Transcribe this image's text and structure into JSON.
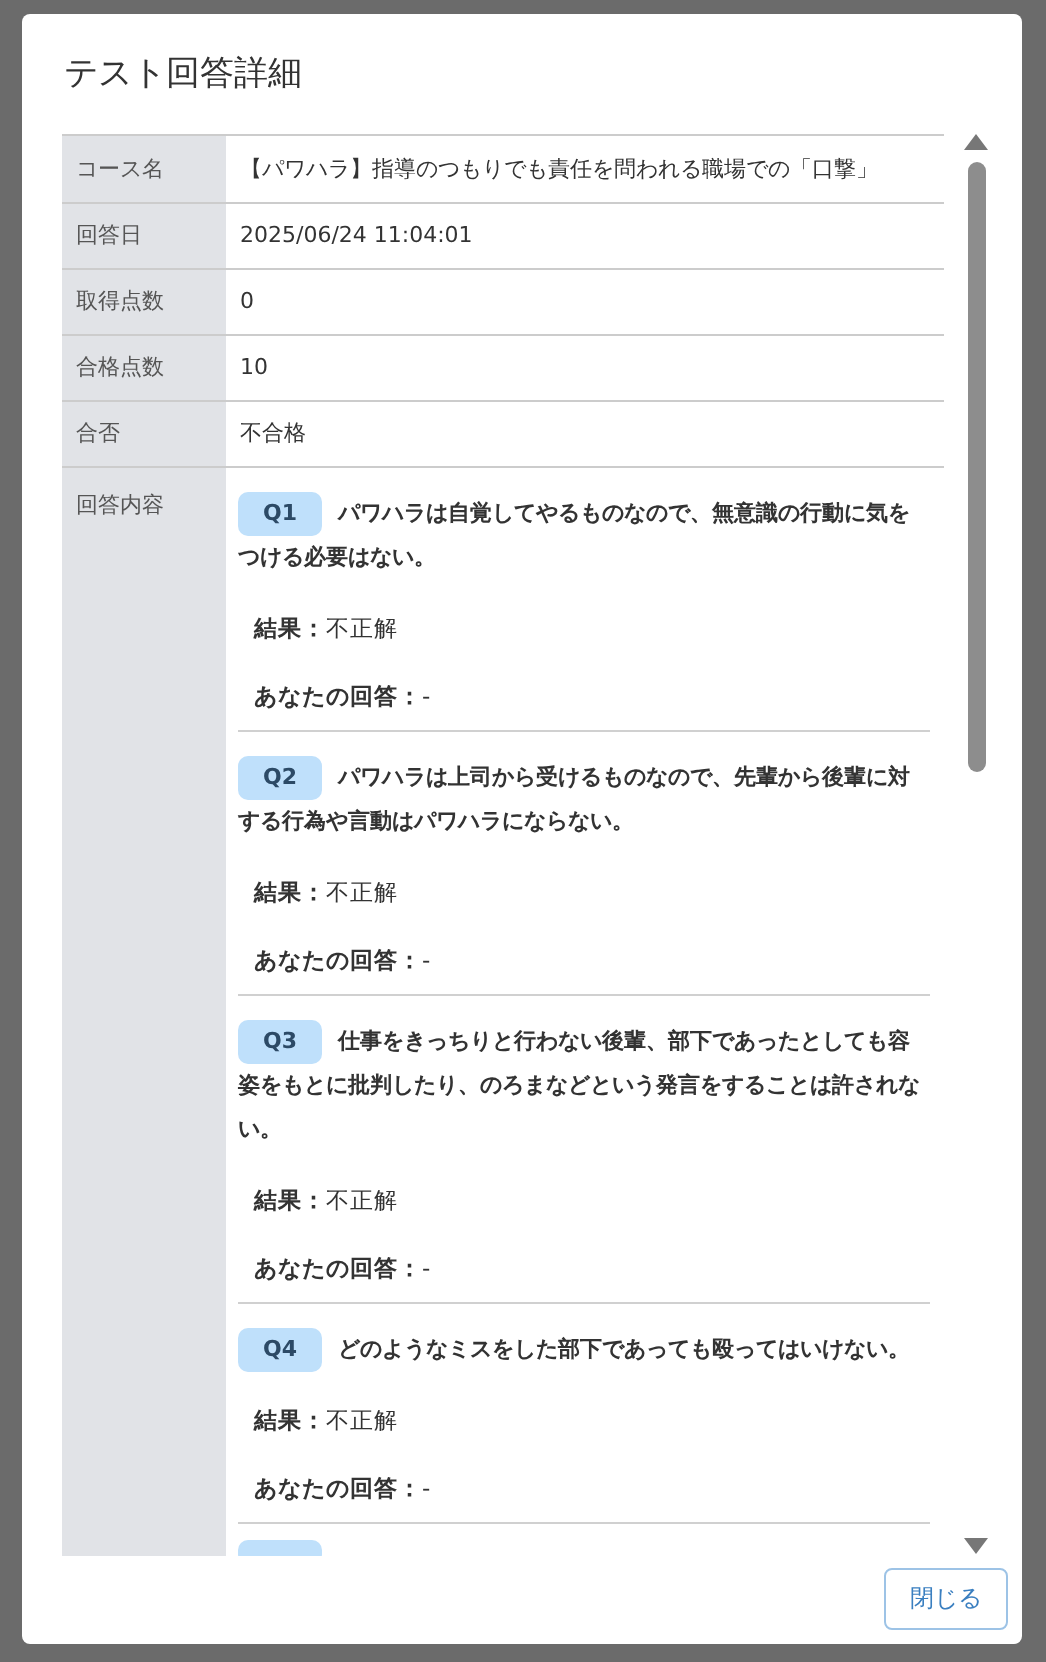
{
  "dialog": {
    "title": "テスト回答詳細",
    "details": [
      {
        "label": "コース名",
        "value": "【パワハラ】指導のつもりでも責任を問われる職場での「口撃」"
      },
      {
        "label": "回答日",
        "value": "2025/06/24 11:04:01"
      },
      {
        "label": "取得点数",
        "value": "0"
      },
      {
        "label": "合格点数",
        "value": "10"
      },
      {
        "label": "合否",
        "value": "不合格"
      }
    ],
    "answers_label": "回答内容",
    "questions": [
      {
        "number": "Q1",
        "text": "パワハラは自覚してやるものなので、無意識の行動に気をつける必要はない。",
        "result_label": "結果：",
        "result": "不正解",
        "answer_label": "あなたの回答：",
        "answer": "-"
      },
      {
        "number": "Q2",
        "text": "パワハラは上司から受けるものなので、先輩から後輩に対する行為や言動はパワハラにならない。",
        "result_label": "結果：",
        "result": "不正解",
        "answer_label": "あなたの回答：",
        "answer": "-"
      },
      {
        "number": "Q3",
        "text": "仕事をきっちりと行わない後輩、部下であったとしても容姿をもとに批判したり、のろまなどという発言をすることは許されない。",
        "result_label": "結果：",
        "result": "不正解",
        "answer_label": "あなたの回答：",
        "answer": "-"
      },
      {
        "number": "Q4",
        "text": "どのようなミスをした部下であっても殴ってはいけない。",
        "result_label": "結果：",
        "result": "不正解",
        "answer_label": "あなたの回答：",
        "answer": "-"
      }
    ],
    "close_button": "閉じる"
  }
}
